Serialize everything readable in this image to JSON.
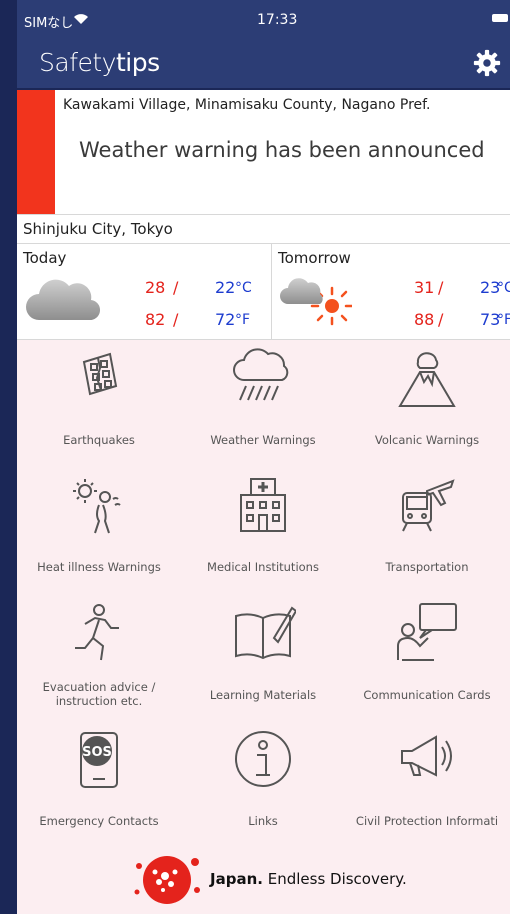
{
  "status": {
    "carrier": "SIMなし",
    "time": "17:33"
  },
  "nav": {
    "title_light": "Safety",
    "title_bold": "tips",
    "settings_icon": "gear-icon"
  },
  "alert": {
    "location": "Kawakami Village, Minamisaku County, Nagano Pref.",
    "message": "Weather warning has been announced",
    "color": "#f2341d"
  },
  "weather": {
    "city": "Shinjuku City, Tokyo",
    "today": {
      "label": "Today",
      "icon": "cloud-icon",
      "high_c": "28",
      "low_c": "22",
      "unit_c": "°C",
      "high_f": "82",
      "low_f": "72",
      "unit_f": "°F"
    },
    "tomorrow": {
      "label": "Tomorrow",
      "icon": "cloud-sun-icon",
      "high_c": "31",
      "low_c": "23",
      "unit_c": "°C",
      "high_f": "88",
      "low_f": "73",
      "unit_f": "°F"
    },
    "colors": {
      "high": "#e4231c",
      "low": "#1d3ccf"
    }
  },
  "menu": [
    {
      "label": "Earthquakes",
      "icon": "cracked-building-icon"
    },
    {
      "label": "Weather Warnings",
      "icon": "rain-cloud-icon"
    },
    {
      "label": "Volcanic Warnings",
      "icon": "volcano-icon"
    },
    {
      "label": "Heat illness Warnings",
      "icon": "heatstroke-icon"
    },
    {
      "label": "Medical Institutions",
      "icon": "hospital-icon"
    },
    {
      "label": "Transportation",
      "icon": "train-plane-icon"
    },
    {
      "label": "Evacuation advice / instruction etc.",
      "icon": "running-person-icon"
    },
    {
      "label": "Learning Materials",
      "icon": "open-book-icon"
    },
    {
      "label": "Communication Cards",
      "icon": "speech-person-icon"
    },
    {
      "label": "Emergency Contacts",
      "icon": "sos-phone-icon"
    },
    {
      "label": "Links",
      "icon": "info-icon"
    },
    {
      "label": "Civil Protection Informati",
      "icon": "megaphone-icon"
    }
  ],
  "footer": {
    "brand_bold": "Japan.",
    "brand_rest": " Endless Discovery.",
    "logo": "cherry-blossom-logo",
    "logo_color": "#e4231c"
  }
}
